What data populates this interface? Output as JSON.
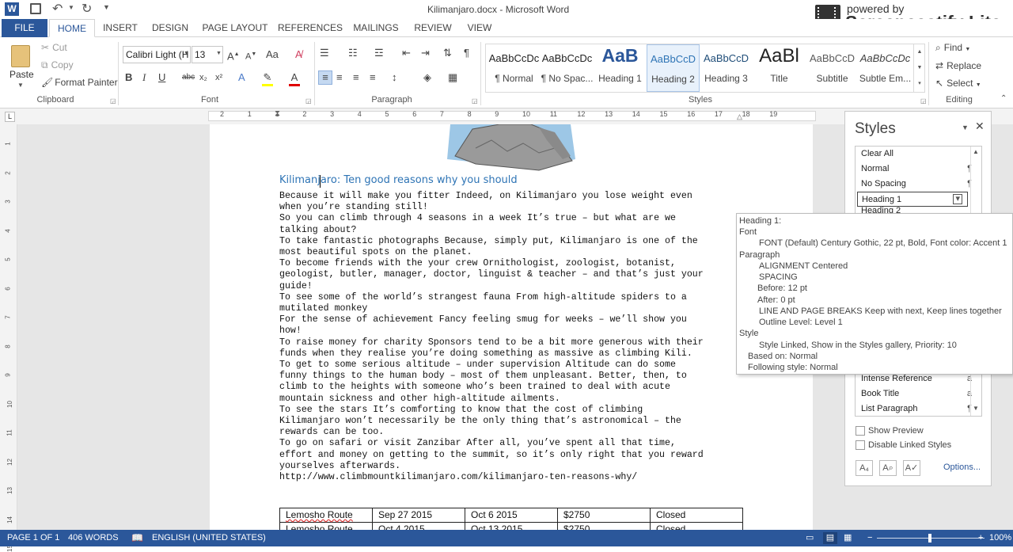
{
  "window": {
    "title": "Kilimanjaro.docx - Microsoft Word",
    "app_icon": "word-icon"
  },
  "watermark": {
    "line1": "powered by",
    "line2": "Screencastify Lite"
  },
  "tabs": [
    {
      "label": "FILE"
    },
    {
      "label": "HOME",
      "active": true
    },
    {
      "label": "INSERT"
    },
    {
      "label": "DESIGN"
    },
    {
      "label": "PAGE LAYOUT"
    },
    {
      "label": "REFERENCES"
    },
    {
      "label": "MAILINGS"
    },
    {
      "label": "REVIEW"
    },
    {
      "label": "VIEW"
    }
  ],
  "clipboard": {
    "paste": "Paste",
    "cut": "Cut",
    "copy": "Copy",
    "format_painter": "Format Painter",
    "group": "Clipboard"
  },
  "font": {
    "name": "Calibri Light (H",
    "size": "13",
    "group": "Font",
    "change_case": "Aa",
    "bold": "B",
    "italic": "I",
    "underline": "U",
    "strike": "abc",
    "sub": "x₂",
    "sup": "x²"
  },
  "paragraph": {
    "group": "Paragraph"
  },
  "styles": {
    "group": "Styles",
    "gallery": [
      {
        "preview": "AaBbCcDc",
        "name": "¶ Normal"
      },
      {
        "preview": "AaBbCcDc",
        "name": "¶ No Spac..."
      },
      {
        "preview": "AaB",
        "name": "Heading 1"
      },
      {
        "preview": "AaBbCcD",
        "name": "Heading 2",
        "selected": true
      },
      {
        "preview": "AaBbCcD",
        "name": "Heading 3"
      },
      {
        "preview": "AaBl",
        "name": "Title"
      },
      {
        "preview": "AaBbCcD",
        "name": "Subtitle"
      },
      {
        "preview": "AaBbCcDc",
        "name": "Subtle Em..."
      }
    ]
  },
  "editing": {
    "find": "Find",
    "replace": "Replace",
    "select": "Select",
    "group": "Editing"
  },
  "ruler": {
    "ticks": [
      "2",
      "1",
      "1",
      "2",
      "3",
      "4",
      "5",
      "6",
      "7",
      "8",
      "9",
      "10",
      "11",
      "12",
      "13",
      "14",
      "15",
      "16",
      "17",
      "18",
      "19"
    ],
    "vticks": [
      "1",
      "2",
      "3",
      "4",
      "5",
      "6",
      "7",
      "8",
      "9",
      "10",
      "11",
      "12",
      "13",
      "14",
      "15"
    ]
  },
  "document": {
    "heading": "Kilimanjaro: Ten good reasons why you should",
    "lines": [
      "Because it will make you fitter Indeed, on Kilimanjaro you lose weight even",
      "when you’re standing still!",
      "So you can climb through 4 seasons in a week It’s true – but what are we",
      "talking about?",
      "To take fantastic photographs Because, simply put, Kilimanjaro is one of the",
      "most beautiful spots on the planet.",
      "To become friends with the your crew Ornithologist, zoologist, botanist,",
      "geologist, butler, manager, doctor, linguist & teacher – and that’s just your",
      "guide!",
      "To see some of the world’s strangest fauna From high-altitude spiders to a",
      "mutilated monkey",
      "For the sense of achievement Fancy feeling smug for weeks – we’ll show you",
      "how!",
      "To raise money for charity Sponsors tend to be a bit more generous with their",
      "funds when they realise you’re doing something as massive as climbing Kili.",
      "To get to some serious altitude – under supervision Altitude can do some",
      "funny things to the human body – most of them unpleasant. Better, then, to",
      "climb to the heights with someone who’s been trained to deal with acute",
      "mountain sickness and other high-altitude ailments.",
      "To see the stars It’s comforting to know that the cost of climbing",
      "Kilimanjaro won’t necessarily be the only thing that’s astronomical – the",
      "rewards can be too.",
      "To go on safari or visit Zanzibar After all, you’ve spent all that time,",
      "effort and money on getting to the summit, so it’s only right that you reward",
      "yourselves afterwards.",
      "http://www.climbmountkilimanjaro.com/kilimanjaro-ten-reasons-why/"
    ],
    "table": [
      [
        "Lemosho Route",
        "Sep 27 2015",
        "Oct 6 2015",
        "$2750",
        "Closed"
      ],
      [
        "Lemosho Route",
        "Oct 4 2015",
        "Oct 13 2015",
        "$2750",
        "Closed"
      ]
    ]
  },
  "styles_pane": {
    "title": "Styles",
    "items": [
      {
        "label": "Clear All",
        "mark": ""
      },
      {
        "label": "Normal",
        "mark": "¶"
      },
      {
        "label": "No Spacing",
        "mark": "¶"
      },
      {
        "label": "Heading 1",
        "mark": "▾"
      },
      {
        "label": "Heading 2",
        "mark": "¶"
      }
    ],
    "items_bottom": [
      {
        "label": "Intense Reference",
        "mark": "a"
      },
      {
        "label": "Book Title",
        "mark": "a"
      },
      {
        "label": "List Paragraph",
        "mark": "¶"
      }
    ],
    "show_preview": "Show Preview",
    "disable_linked": "Disable Linked Styles",
    "options": "Options..."
  },
  "tooltip": {
    "lines": [
      "Heading 1:",
      "Font",
      "FONT  (Default) Century Gothic, 22 pt, Bold, Font color: Accent 1",
      "Paragraph",
      "ALIGNMENT  Centered",
      "SPACING",
      "Before:  12 pt",
      "After:  0 pt",
      "LINE AND PAGE BREAKS  Keep with next, Keep lines together",
      "Outline Level:  Level 1",
      "Style",
      "Style Linked, Show in the Styles gallery, Priority: 10",
      "Based on: Normal",
      "Following style: Normal"
    ]
  },
  "status": {
    "page": "PAGE 1 OF 1",
    "words": "406 WORDS",
    "language": "ENGLISH (UNITED STATES)",
    "zoom": "100%"
  }
}
